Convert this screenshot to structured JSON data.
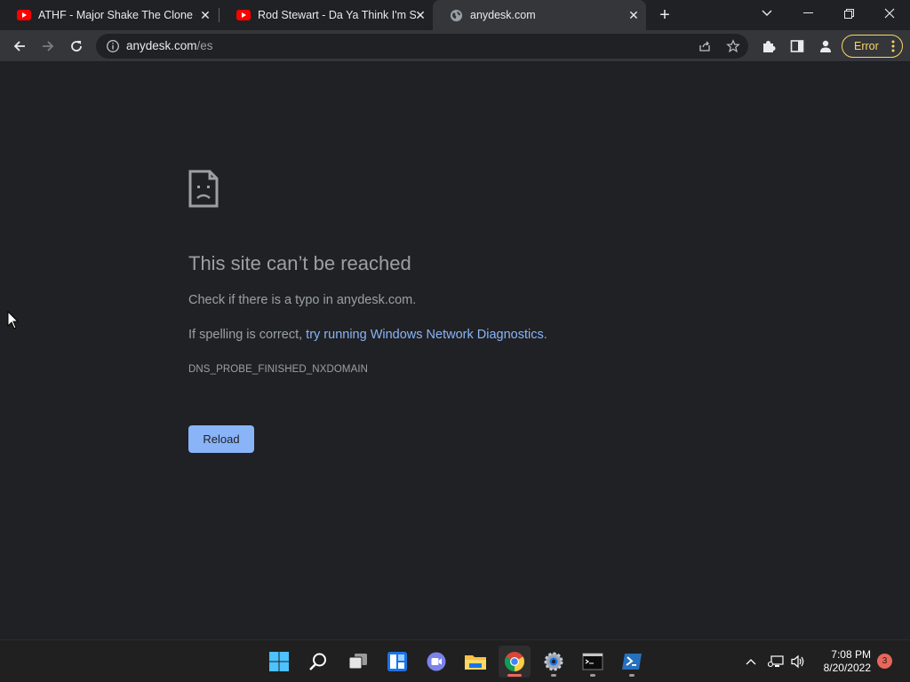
{
  "browser": {
    "tabs": [
      {
        "title": "ATHF - Major Shake The Clone - Y",
        "icon": "youtube-icon",
        "active": false
      },
      {
        "title": "Rod Stewart - Da Ya Think I'm Sexy",
        "icon": "youtube-icon",
        "active": false
      },
      {
        "title": "anydesk.com",
        "icon": "globe-icon",
        "active": true
      }
    ],
    "new_tab_label": "+",
    "address": {
      "host": "anydesk.com",
      "path": "/es"
    },
    "error_chip_label": "Error",
    "colors": {
      "link": "#8ab4f8",
      "error_chip": "#fdd663",
      "background": "#202124",
      "toolbar": "#35363a"
    }
  },
  "error_page": {
    "headline": "This site can’t be reached",
    "check_text": "Check if there is a typo in anydesk.com.",
    "spelling_prefix": "If spelling is correct, ",
    "diagnostics_link": "try running Windows Network Diagnostics",
    "spelling_suffix": ".",
    "error_code": "DNS_PROBE_FINISHED_NXDOMAIN",
    "reload_label": "Reload"
  },
  "taskbar": {
    "apps": [
      "start-icon",
      "search-icon",
      "task-view-icon",
      "widgets-icon",
      "teams-chat-icon",
      "file-explorer-icon",
      "chrome-icon",
      "settings-icon",
      "terminal-icon",
      "powershell-icon"
    ],
    "clock_time": "7:08 PM",
    "clock_date": "8/20/2022",
    "notification_count": "3"
  }
}
